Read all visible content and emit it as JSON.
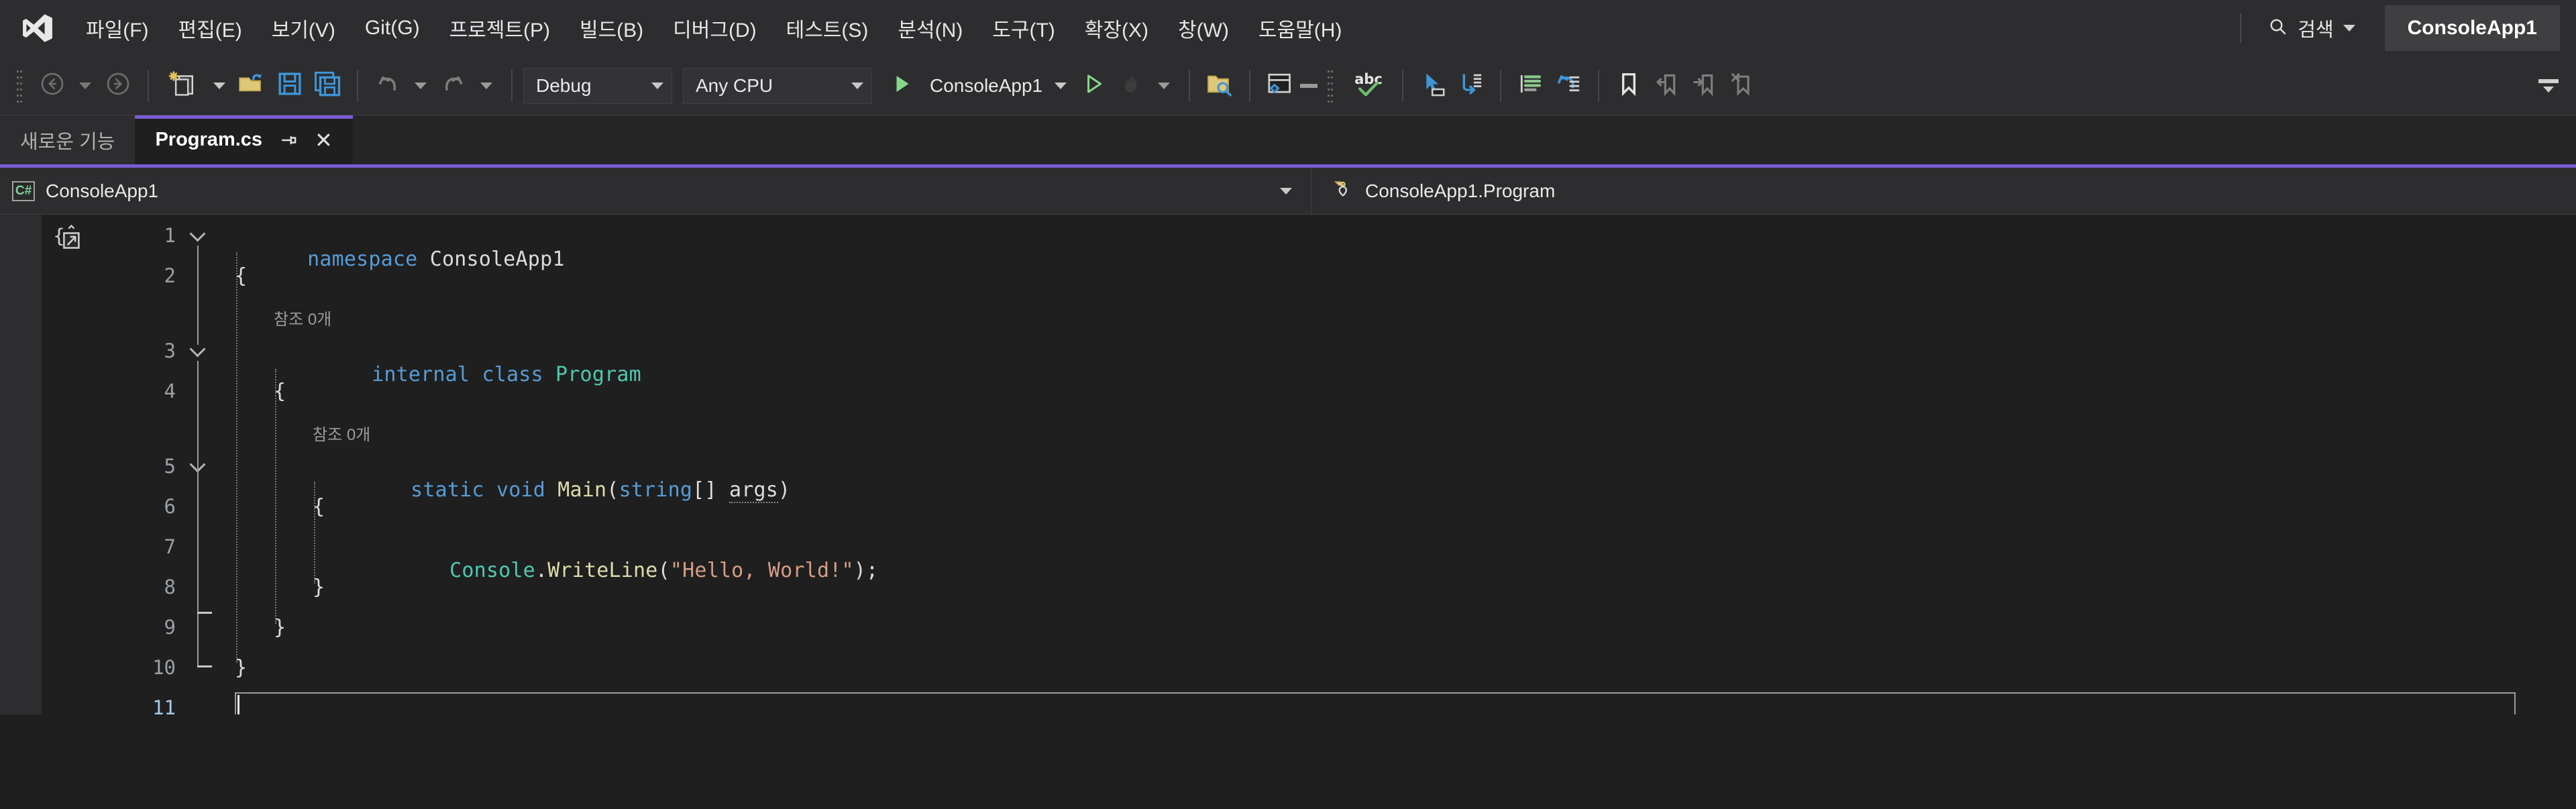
{
  "app": {
    "logo_icon": "visual-studio-logo",
    "project_chip": "ConsoleApp1"
  },
  "menubar": {
    "items": [
      {
        "label": "파일(F)",
        "name": "file"
      },
      {
        "label": "편집(E)",
        "name": "edit"
      },
      {
        "label": "보기(V)",
        "name": "view"
      },
      {
        "label": "Git(G)",
        "name": "git"
      },
      {
        "label": "프로젝트(P)",
        "name": "project"
      },
      {
        "label": "빌드(B)",
        "name": "build"
      },
      {
        "label": "디버그(D)",
        "name": "debug"
      },
      {
        "label": "테스트(S)",
        "name": "test"
      },
      {
        "label": "분석(N)",
        "name": "analyze"
      },
      {
        "label": "도구(T)",
        "name": "tools"
      },
      {
        "label": "확장(X)",
        "name": "extensions"
      },
      {
        "label": "창(W)",
        "name": "window"
      },
      {
        "label": "도움말(H)",
        "name": "help"
      }
    ],
    "search_label": "검색",
    "search_icon": "search-icon"
  },
  "toolbar": {
    "back_icon": "navigate-back-icon",
    "forward_icon": "navigate-forward-icon",
    "new_project_icon": "new-project-icon",
    "open_file_icon": "open-file-icon",
    "save_icon": "save-icon",
    "save_all_icon": "save-all-icon",
    "undo_icon": "undo-icon",
    "redo_icon": "redo-icon",
    "configuration": "Debug",
    "platform": "Any CPU",
    "run_label": "ConsoleApp1",
    "start_icon": "start-debug-icon",
    "start_no_debug_icon": "start-without-debugging-icon",
    "hot_reload_icon": "hot-reload-flame-icon",
    "find_in_files_icon": "find-in-files-icon",
    "live_share_icon": "live-share-icon",
    "spell_check_icon": "spell-check-abc-icon",
    "selection_icon": "pointer-select-icon",
    "line_wrap_icon": "line-wrap-icon",
    "indent_guides_icon": "indent-guides-icon",
    "undo_history_icon": "undo-history-icon",
    "bookmark_icon": "bookmark-icon",
    "prev_bookmark_icon": "previous-bookmark-icon",
    "next_bookmark_icon": "next-bookmark-icon",
    "clear_bookmark_icon": "clear-bookmark-icon",
    "overflow_icon": "toolbar-overflow-icon"
  },
  "tabs": [
    {
      "label": "새로운 기능",
      "active": false,
      "name": "whats-new"
    },
    {
      "label": "Program.cs",
      "active": true,
      "name": "program-cs",
      "pin_icon": "pin-icon",
      "close_icon": "close-icon"
    }
  ],
  "navbar": {
    "project": "ConsoleApp1",
    "project_icon": "csharp-project-icon",
    "member": "ConsoleApp1.Program",
    "member_icon": "class-icon",
    "dropdown_icon": "chevron-down-icon"
  },
  "editor": {
    "expand_icon": "expand-all-outlining-icon",
    "codelens_namespace": "참조 0개",
    "codelens_class": "참조 0개",
    "lines": [
      {
        "num": "1",
        "indent": 0,
        "text": "namespace ConsoleApp1"
      },
      {
        "num": "2",
        "indent": 0,
        "text": "{"
      },
      {
        "num": "3",
        "indent": 1,
        "text": "internal class Program"
      },
      {
        "num": "4",
        "indent": 1,
        "text": "{"
      },
      {
        "num": "5",
        "indent": 2,
        "text": "static void Main(string[] args)"
      },
      {
        "num": "6",
        "indent": 2,
        "text": "{"
      },
      {
        "num": "7",
        "indent": 3,
        "text": "Console.WriteLine(\"Hello, World!\");"
      },
      {
        "num": "8",
        "indent": 2,
        "text": "}"
      },
      {
        "num": "9",
        "indent": 1,
        "text": "}"
      },
      {
        "num": "10",
        "indent": 0,
        "text": "}"
      },
      {
        "num": "11",
        "indent": 0,
        "text": ""
      }
    ],
    "cursor_line": "11"
  },
  "colors": {
    "accent_purple": "#7a5cd6",
    "keyword_blue": "#569cd6",
    "type_teal": "#4ec9b0",
    "method_yellow": "#dcdcaa",
    "string_orange": "#d69d85",
    "editor_bg": "#1f1f1f",
    "chrome_bg": "#2d2d30",
    "run_green": "#84d888"
  }
}
